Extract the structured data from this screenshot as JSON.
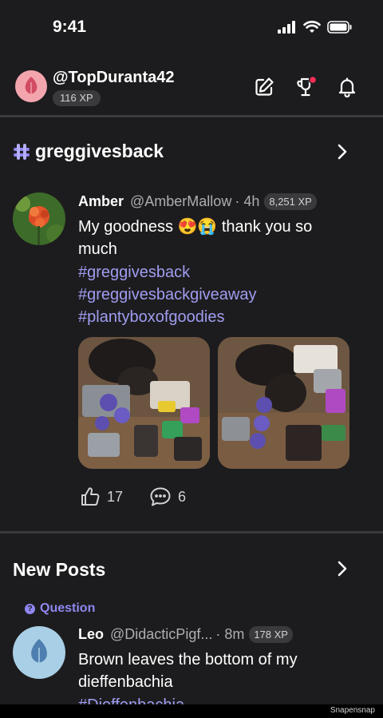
{
  "status_bar": {
    "time": "9:41"
  },
  "header": {
    "username": "@TopDuranta42",
    "xp": "116 XP",
    "icons": [
      "edit-icon",
      "trophy-icon",
      "bell-icon"
    ]
  },
  "community": {
    "title": "greggivesback"
  },
  "post": {
    "author_name": "Amber",
    "author_handle": "@AmberMallow",
    "time": "· 4h",
    "xp": "8,251 XP",
    "text_line1": "My goodness 😍😭 thank you so",
    "text_line2": "much",
    "hashtags": [
      "#greggivesback",
      "#greggivesbackgiveaway",
      "#plantyboxofgoodies"
    ],
    "likes": "17",
    "comments": "6"
  },
  "new_posts": {
    "title": "New Posts",
    "item": {
      "label": "Question",
      "author_name": "Leo",
      "author_handle": "@DidacticPigf...",
      "time": "· 8m",
      "xp": "178 XP",
      "text_line1": "Brown leaves the bottom of my",
      "text_line2": "dieffenbachia",
      "hashtag_partial": "#Dieffenbachia"
    }
  },
  "watermark": "Snapensnap",
  "colors": {
    "background": "#1c1c1e",
    "accent": "#8f86f0",
    "hashtag": "#a09cf0",
    "avatar_pink": "#f3a5ae",
    "avatar_blue": "#a9cfe6"
  }
}
